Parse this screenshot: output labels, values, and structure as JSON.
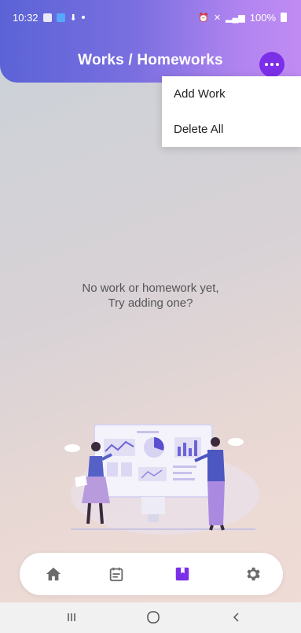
{
  "status_bar": {
    "time": "10:32",
    "battery_text": "100%"
  },
  "header": {
    "title": "Works / Homeworks"
  },
  "menu": {
    "items": [
      {
        "label": "Add Work"
      },
      {
        "label": "Delete All"
      }
    ]
  },
  "empty_state": {
    "line1": "No work or homework yet,",
    "line2": "Try adding one?"
  },
  "bottom_nav": {
    "items": [
      {
        "icon": "home-icon"
      },
      {
        "icon": "calendar-icon"
      },
      {
        "icon": "book-icon",
        "active": true
      },
      {
        "icon": "settings-icon"
      }
    ],
    "active_color": "#7c2fe8",
    "inactive_color": "#6b6b6b"
  },
  "system_nav": {
    "items": [
      {
        "icon": "recents-icon"
      },
      {
        "icon": "home-circle-icon"
      },
      {
        "icon": "back-icon"
      }
    ]
  },
  "colors": {
    "accent": "#7c2fe8",
    "header_start": "#5b63d6",
    "header_end": "#c08cf3"
  }
}
